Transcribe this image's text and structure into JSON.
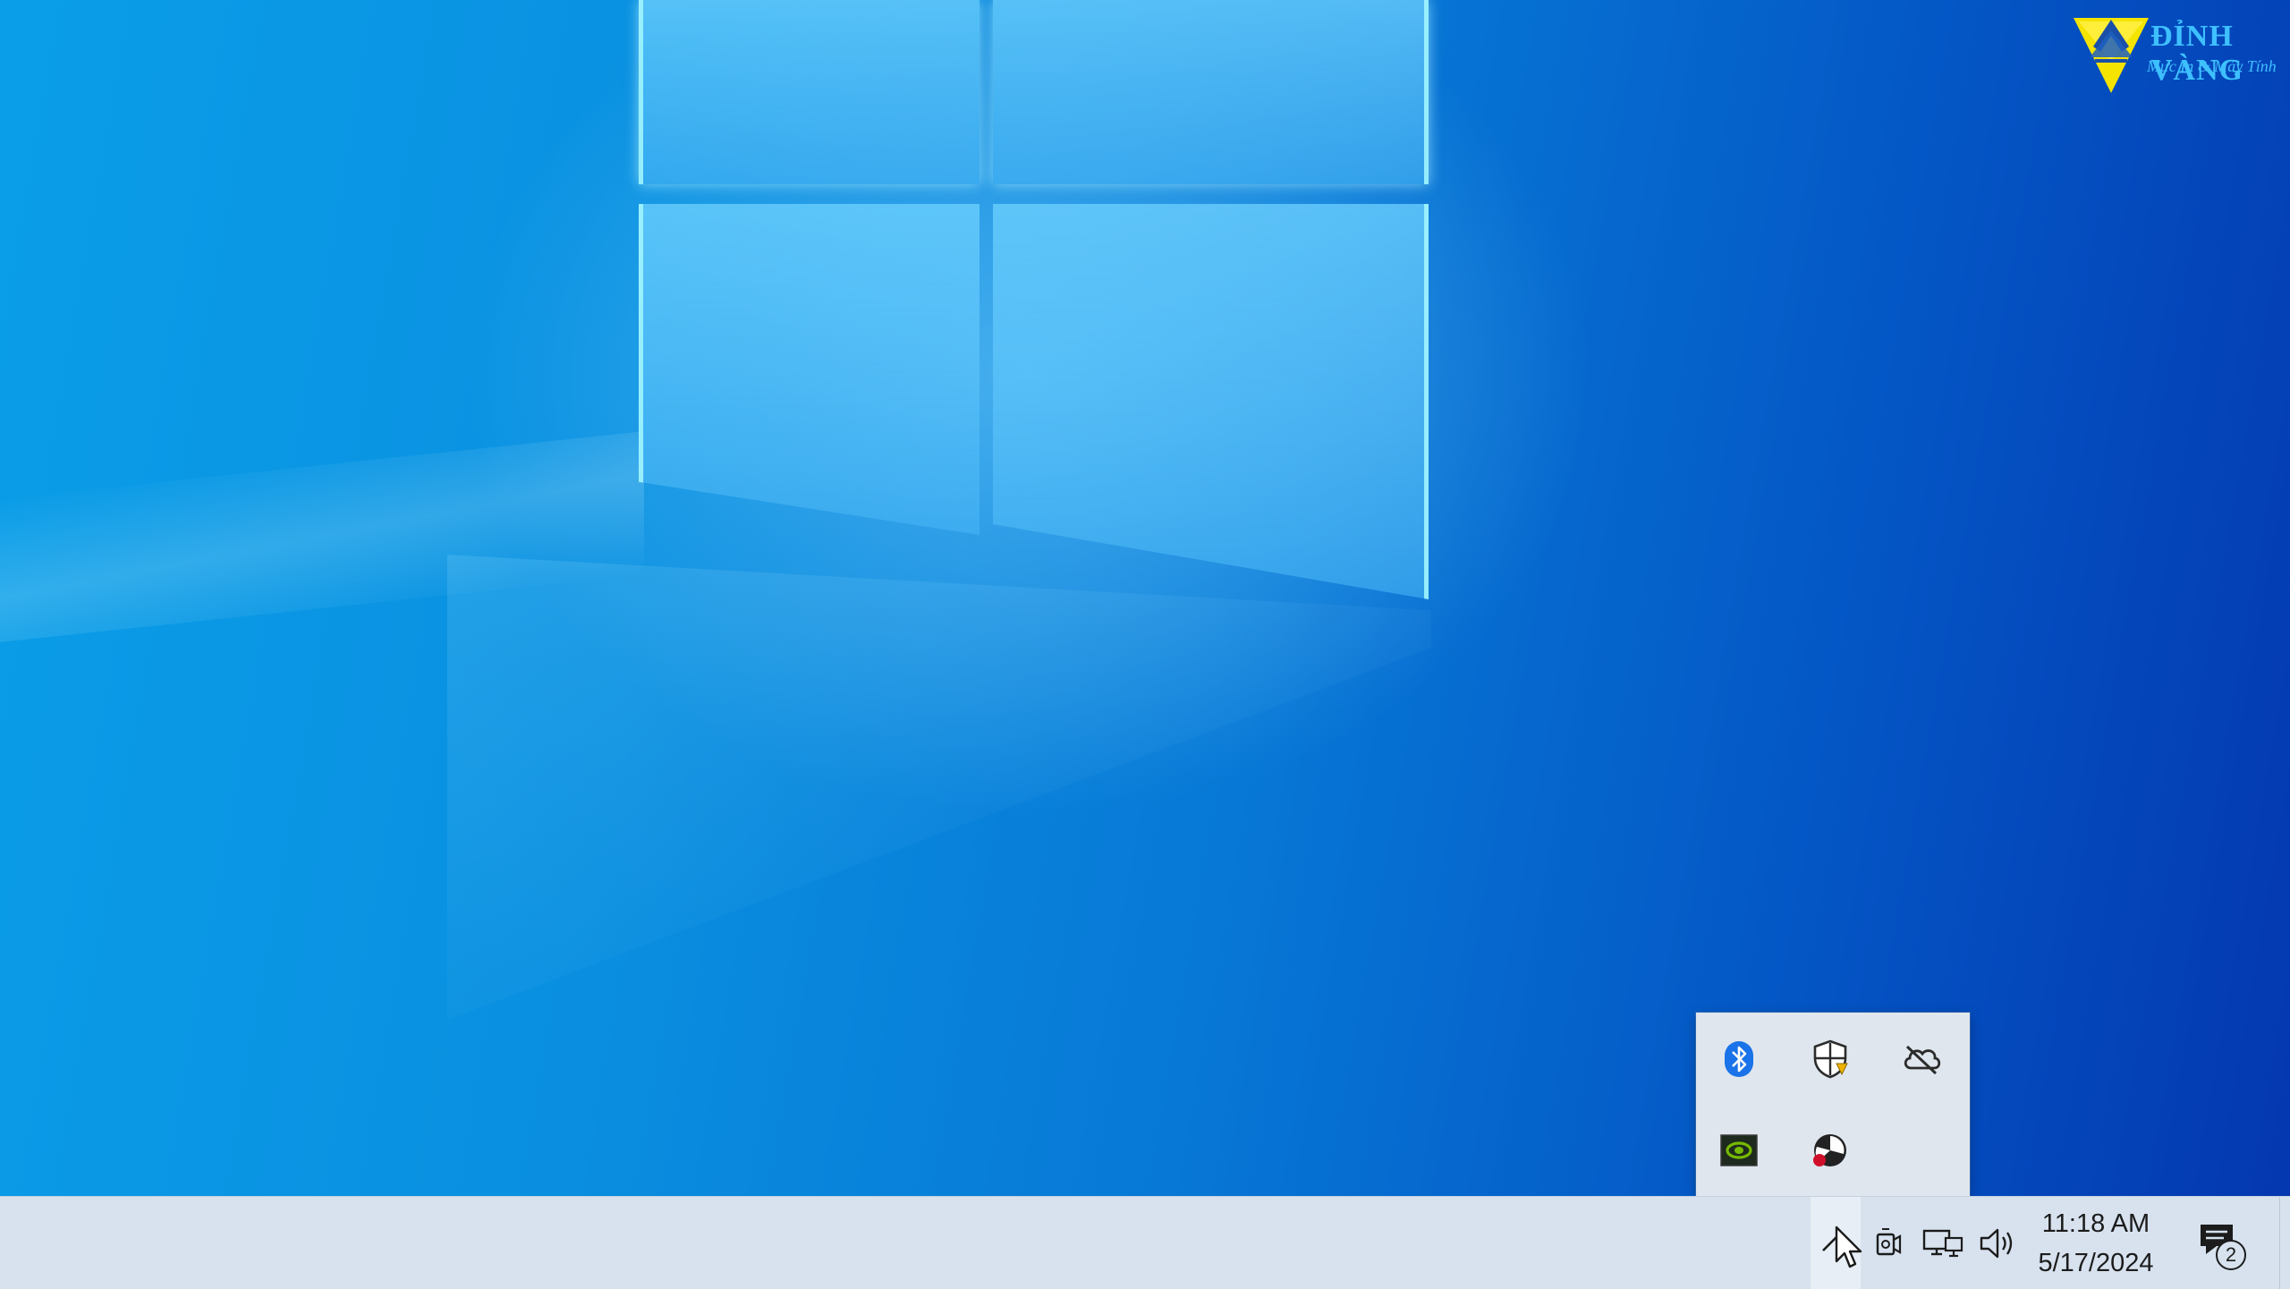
{
  "brand": {
    "name": "ĐỈNH VÀNG",
    "tagline": "Mực In & Máy Tính",
    "color": "#3ec0ff"
  },
  "tray_flyout": {
    "icons": [
      {
        "name": "bluetooth-icon",
        "color": "#1a73e8"
      },
      {
        "name": "security-shield-icon",
        "color": "#2b2b2b"
      },
      {
        "name": "onedrive-offline-icon",
        "color": "#2b2b2b"
      },
      {
        "name": "nvidia-icon",
        "color": "#76b900"
      },
      {
        "name": "app-tray-icon",
        "color": "#d0102a"
      }
    ]
  },
  "taskbar": {
    "tray_icons": [
      "chevron-up-icon",
      "meet-now-icon",
      "network-icon",
      "volume-icon"
    ],
    "clock": {
      "time": "11:18 AM",
      "date": "5/17/2024"
    },
    "notifications": {
      "count": "2"
    }
  },
  "colors": {
    "taskbar_bg": "#d7e2ee",
    "flyout_bg": "#dfe6ee",
    "desktop_accent": "#0778d6"
  }
}
